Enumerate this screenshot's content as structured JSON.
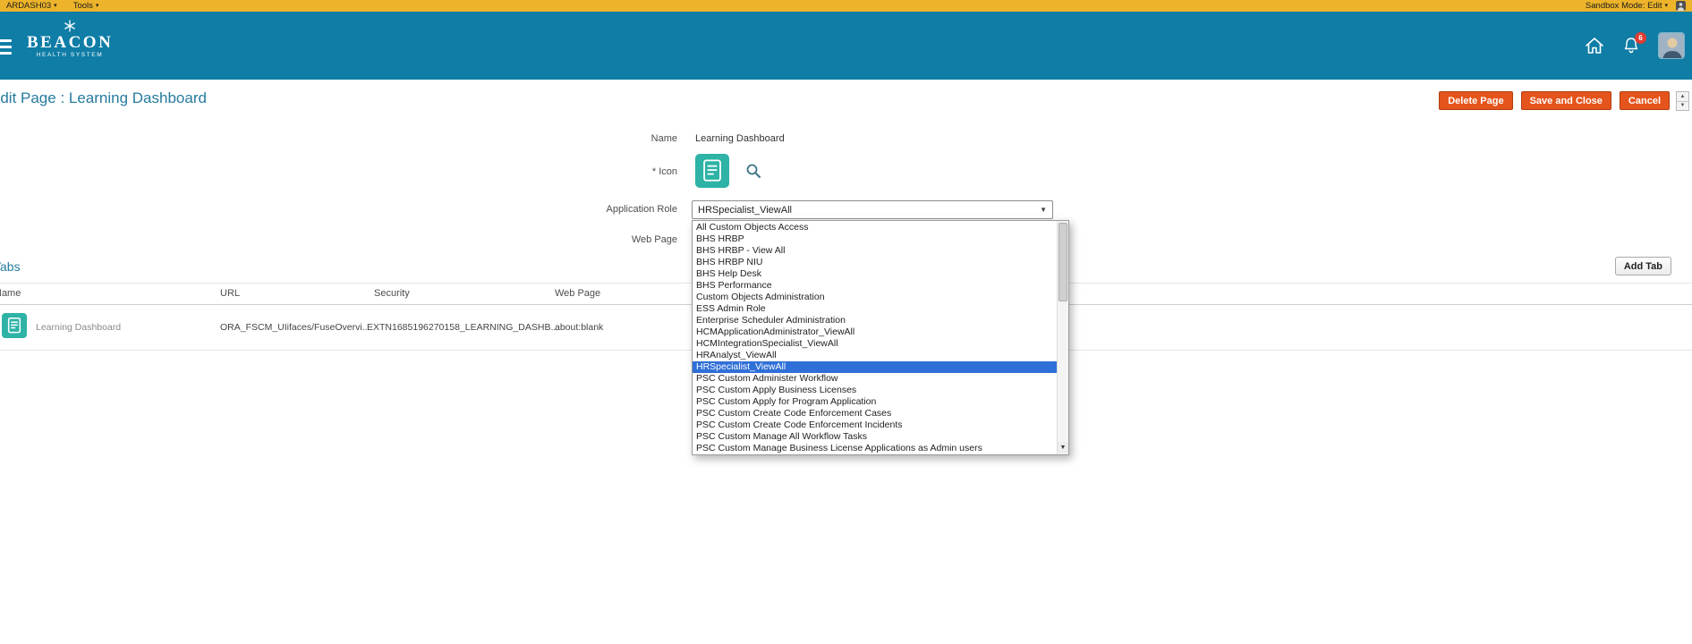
{
  "colors": {
    "sandbox-gold": "#EDB32A",
    "header-teal": "#0F7DA6",
    "title-teal": "#267B9E",
    "button-orange": "#E5541C",
    "highlight-blue": "#2F6FD8",
    "icon-teal": "#2EB3A6"
  },
  "sandbox_bar": {
    "sandbox_name": "ARDASH03",
    "tools_label": "Tools",
    "mode_label": "Sandbox Mode: Edit"
  },
  "header": {
    "brand_name": "BEACON",
    "brand_subtitle": "HEALTH SYSTEM",
    "notification_count": "6"
  },
  "page": {
    "title": "Edit Page : Learning Dashboard",
    "delete_button": "Delete Page",
    "save_button": "Save and Close",
    "cancel_button": "Cancel"
  },
  "form": {
    "name_label": "Name",
    "name_value": "Learning Dashboard",
    "icon_label": "* Icon",
    "application_role_label": "Application Role",
    "application_role_value": "HRSpecialist_ViewAll",
    "web_page_label": "Web Page",
    "dropdown": {
      "selected": "HRSpecialist_ViewAll",
      "options": [
        "All Custom Objects Access",
        "BHS HRBP",
        "BHS HRBP - View All",
        "BHS HRBP NIU",
        "BHS Help Desk",
        "BHS Performance",
        "Custom Objects Administration",
        "ESS Admin Role",
        "Enterprise Scheduler Administration",
        "HCMApplicationAdministrator_ViewAll",
        "HCMIntegrationSpecialist_ViewAll",
        "HRAnalyst_ViewAll",
        "HRSpecialist_ViewAll",
        "PSC Custom Administer Workflow",
        "PSC Custom Apply Business Licenses",
        "PSC Custom Apply for Program Application",
        "PSC Custom Create Code Enforcement Cases",
        "PSC Custom Create Code Enforcement Incidents",
        "PSC Custom Manage All Workflow Tasks",
        "PSC Custom Manage Business License Applications as Admin users"
      ]
    }
  },
  "tabs_section": {
    "title": "Tabs",
    "add_tab_label": "Add Tab",
    "columns": [
      "Name",
      "URL",
      "Security",
      "Web Page"
    ],
    "rows": [
      {
        "name": "Learning Dashboard",
        "url": "ORA_FSCM_UIifaces/FuseOvervi...",
        "security": "EXTN1685196270158_LEARNING_DASHB...",
        "web_page": "about:blank"
      }
    ]
  },
  "icons": {
    "chevron_down": "▾",
    "select_chevron": "▼",
    "scroll_up": "▲",
    "scroll_down": "▼"
  }
}
